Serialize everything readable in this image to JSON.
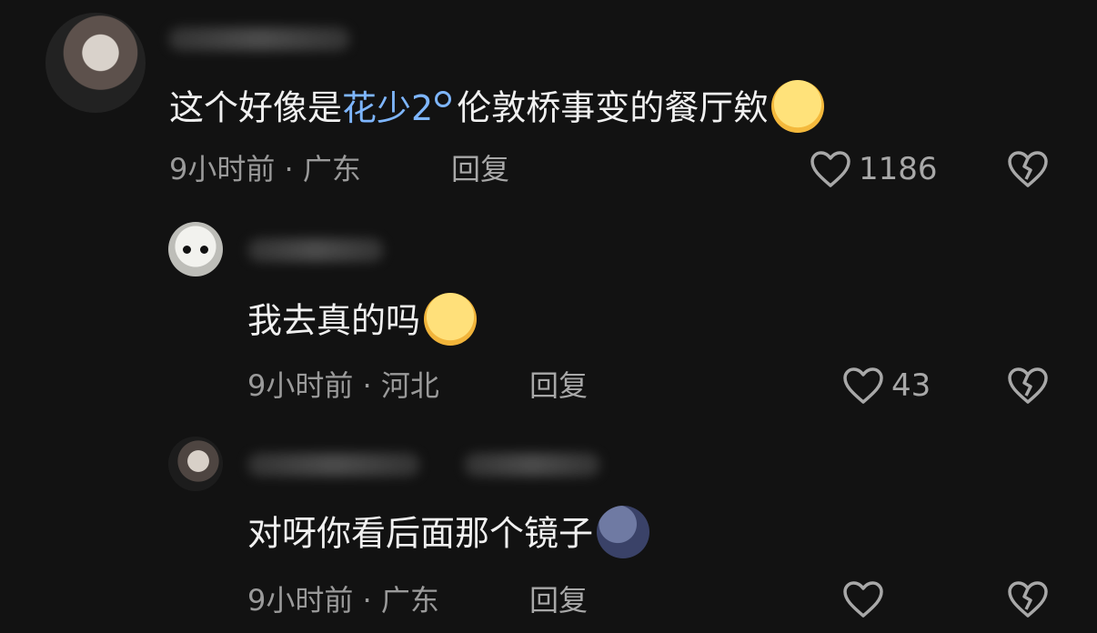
{
  "comments": [
    {
      "username_hint": "",
      "text_before": "这个好像是",
      "text_link": "花少2",
      "text_after": "伦敦桥事变的餐厅欸",
      "time": "9小时前",
      "location": "广东",
      "reply_label": "回复",
      "likes": "1186",
      "emoji": "crying-face-emoji"
    },
    {
      "text": "我去真的吗",
      "time": "9小时前",
      "location": "河北",
      "reply_label": "回复",
      "likes": "43",
      "emoji": "nervous-face-emoji"
    },
    {
      "text": "对呀你看后面那个镜子",
      "time": "9小时前",
      "location": "广东",
      "reply_label": "回复",
      "likes": "",
      "emoji": "new-moon-face-emoji"
    }
  ],
  "separator": "·",
  "colors": {
    "background": "#121212",
    "text": "#f0f0f0",
    "meta": "#9a9a9a",
    "link": "#7eb6ff"
  },
  "icons": [
    "heart-outline-icon",
    "broken-heart-icon",
    "search-icon"
  ]
}
